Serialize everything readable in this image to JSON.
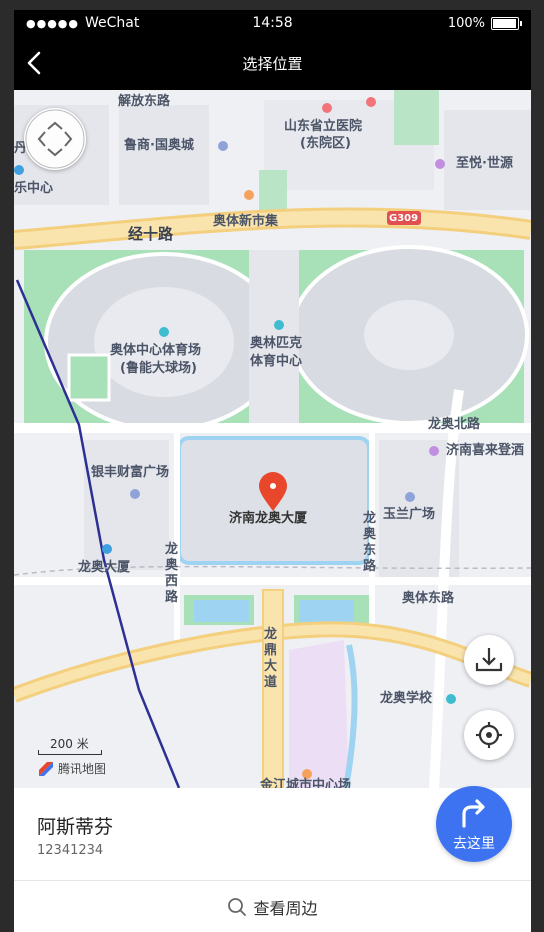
{
  "status_bar": {
    "signal": "●●●●●",
    "carrier": "WeChat",
    "time": "14:58",
    "battery": "100%"
  },
  "nav": {
    "title": "选择位置"
  },
  "map": {
    "labels": {
      "jiefang_east": "解放东路",
      "shandong_hospital_1": "山东省立医院",
      "shandong_hospital_2": "(东院区)",
      "luneng_guoao": "鲁商·国奥城",
      "zhiyue": "至悦·世源",
      "edge_center": "乐中心",
      "edge_top": "丹",
      "jingshi": "经十路",
      "aoti_market": "奥体新市集",
      "highway": "G309",
      "stadium_1": "奥体中心体育场",
      "stadium_2": "(鲁能大球场)",
      "olympic_1": "奥林匹克",
      "olympic_2": "体育中心",
      "longao_north": "龙奥北路",
      "xilai": "济南喜来登酒",
      "yinfeng": "银丰财富广场",
      "building": "济南龙奥大厦",
      "yulan": "玉兰广场",
      "longao_east": "龙奥东路",
      "longao_west": "龙奥西路",
      "longao_tower": "龙奥大厦",
      "aoti_east": "奥体东路",
      "longding": "龙鼎大道",
      "longao_school": "龙奥学校",
      "bottom": "金江城市中心场"
    },
    "scale": "200 米",
    "provider": "腾讯地图"
  },
  "location": {
    "name": "阿斯蒂芬",
    "phone": "12341234"
  },
  "go_button": {
    "label": "去这里"
  },
  "nearby": {
    "label": "查看周边"
  },
  "colors": {
    "accent": "#3d73f0",
    "pin": "#e8472c",
    "green": "#a8e0b8",
    "road": "#f6d58b"
  }
}
